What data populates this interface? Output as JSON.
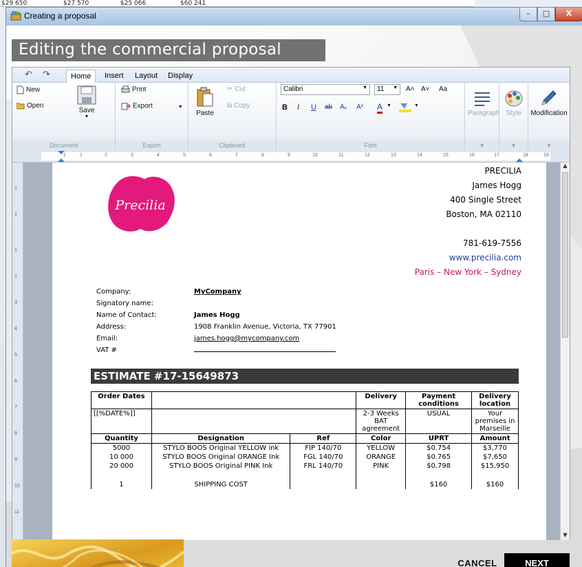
{
  "background": {
    "row_values": [
      "$29 650",
      "$27 570",
      "$25 066",
      "$60 241"
    ]
  },
  "window": {
    "title": "Creating a proposal",
    "controls": {
      "minimize": "–",
      "maximize": "□",
      "close": "X"
    }
  },
  "header": {
    "title": "Editing the commercial proposal"
  },
  "ribbon": {
    "qat": {
      "undo": "↶",
      "redo": "↷"
    },
    "tabs": [
      "Home",
      "Insert",
      "Layout",
      "Display"
    ],
    "document_group": {
      "label": "Document",
      "new": "New",
      "open": "Open",
      "save": "Save"
    },
    "export_group": {
      "label": "Export",
      "print": "Print",
      "export": "Export"
    },
    "clipboard_group": {
      "label": "Clipboard",
      "paste": "Paste",
      "cut": "Cut",
      "copy": "Copy"
    },
    "font_group": {
      "label": "Font",
      "font_name": "Calibri",
      "font_size": "11",
      "grow": "A˄",
      "shrink": "A˅",
      "case": "Aa",
      "bold": "B",
      "italic": "I",
      "underline": "U",
      "strike": "ab",
      "subscript": "Aₓ",
      "superscript": "Aˣ",
      "color": "A"
    },
    "paragraph": "Paragraph",
    "style": "Style",
    "modification": "Modification"
  },
  "ruler": {
    "ticks": [
      "1",
      "1",
      "2",
      "3",
      "4",
      "5",
      "6",
      "7",
      "8",
      "9",
      "10",
      "11",
      "12",
      "13",
      "14",
      "15",
      "16",
      "17",
      "18",
      "19"
    ],
    "v_ticks": [
      "2",
      "1",
      "1",
      "2",
      "3",
      "4",
      "5",
      "6",
      "7",
      "8",
      "9",
      "10",
      "11"
    ]
  },
  "document": {
    "company_block": {
      "name": "PRECILIA",
      "contact": "James Hogg",
      "street": "400 Single Street",
      "city": "Boston, MA 02110",
      "phone": "781-619-7556",
      "website": "www.precilia.com",
      "cities": "Paris – New York – Sydney"
    },
    "logo_text": "Precilia",
    "info": {
      "company_label": "Company:",
      "company_value": "MyCompany",
      "signatory_label": "Signatory name:",
      "contact_label": "Name of Contact:",
      "contact_value": "James Hogg",
      "address_label": "Address:",
      "address_value": "1908 Franklin Avenue, Victoria, TX 77901",
      "email_label": "Email:",
      "email_value": "james.hogg@mycompany.com",
      "vat_label": "VAT #"
    },
    "estimate_title": "ESTIMATE #17-15649873",
    "table": {
      "order_dates": "Order Dates",
      "delivery": "Delivery",
      "payment_conditions": "Payment conditions",
      "delivery_location": "Delivery location",
      "date_value": "[[%DATE%]]",
      "delivery_value": "2-3 Weeks BAT agreement",
      "payment_value": "USUAL",
      "location_value": "Your premises in Marseille",
      "col_quantity": "Quantity",
      "col_designation": "Designation",
      "col_ref": "Ref",
      "col_color": "Color",
      "col_uprt": "UPRT",
      "col_amount": "Amount",
      "items": [
        {
          "qty": "5000",
          "designation": "STYLO BOOS Original YELLOW ink",
          "ref": "FIP 140/70",
          "color": "YELLOW",
          "uprt": "$0.754",
          "amount": "$3,770"
        },
        {
          "qty": "10 000",
          "designation": "STYLO BOOS Original ORANGE Ink",
          "ref": "FGL 140/70",
          "color": "ORANGE",
          "uprt": "$0.765",
          "amount": "$7,650"
        },
        {
          "qty": "20 000",
          "designation": "STYLO BOOS Original PINK Ink",
          "ref": "FRL 140/70",
          "color": "PINK",
          "uprt": "$0.798",
          "amount": "$15,950"
        },
        {
          "qty": "1",
          "designation": "SHIPPING COST",
          "ref": "",
          "color": "",
          "uprt": "$160",
          "amount": "$160"
        }
      ]
    }
  },
  "footer": {
    "cancel": "CANCEL",
    "next": "NEXT"
  },
  "colors": {
    "accent_pink": "#e3197b",
    "header_gray": "#727272",
    "estimate_bar": "#3b3b3b"
  }
}
